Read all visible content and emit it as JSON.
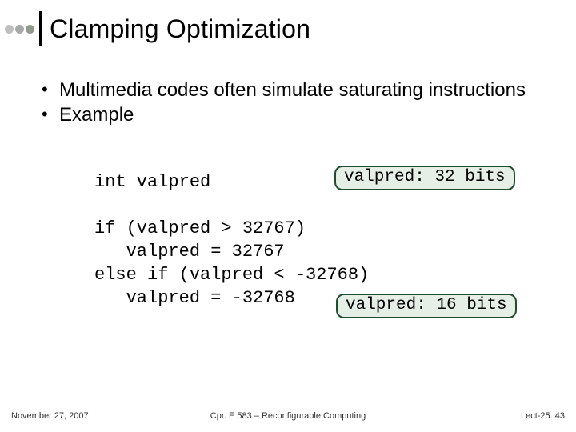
{
  "title": "Clamping Optimization",
  "bullets": {
    "b1": "Multimedia codes often simulate saturating instructions",
    "b2": "Example"
  },
  "code": {
    "decl": "int valpred",
    "l1": "if (valpred > 32767)",
    "l2": "   valpred = 32767",
    "l3": "else if (valpred < -32768)",
    "l4": "   valpred = -32768"
  },
  "badges": {
    "b32": "valpred: 32 bits",
    "b16": "valpred: 16 bits"
  },
  "footer": {
    "left": "November 27, 2007",
    "center": "Cpr. E 583 – Reconfigurable Computing",
    "right": "Lect-25. 43"
  }
}
